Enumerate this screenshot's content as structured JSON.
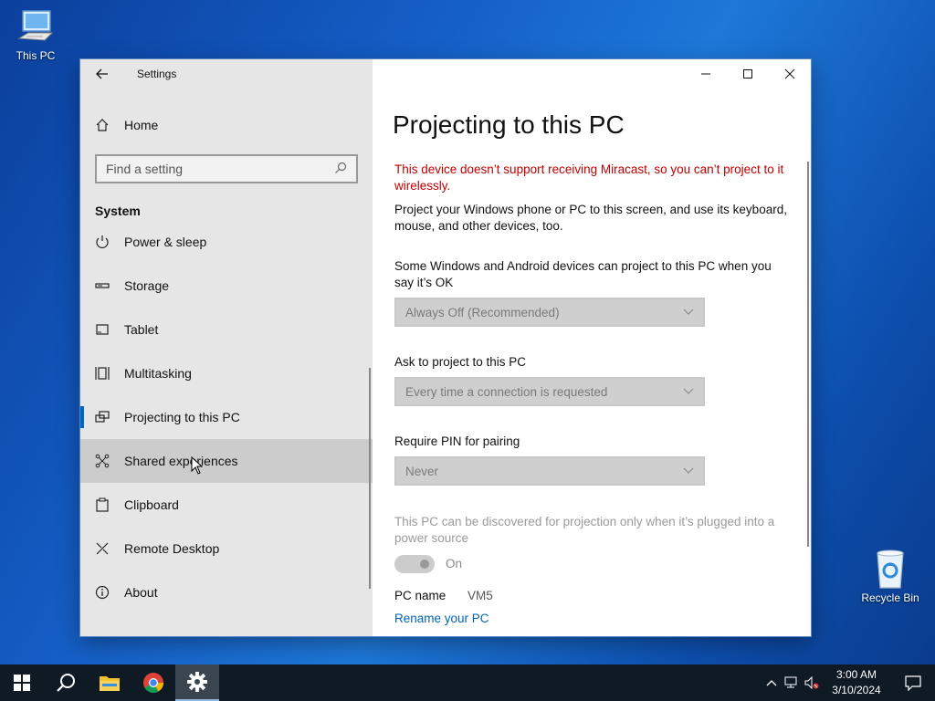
{
  "desktop": {
    "icons": [
      {
        "label": "This PC"
      },
      {
        "label": "Recycle Bin"
      }
    ]
  },
  "window": {
    "title": "Settings",
    "controls": {
      "minimize": "—",
      "maximize": "☐",
      "close": "✕"
    }
  },
  "nav": {
    "home_label": "Home",
    "search_placeholder": "Find a setting",
    "section_title": "System",
    "items": [
      {
        "label": "Power & sleep",
        "icon": "power-icon"
      },
      {
        "label": "Storage",
        "icon": "storage-icon"
      },
      {
        "label": "Tablet",
        "icon": "tablet-icon"
      },
      {
        "label": "Multitasking",
        "icon": "multitasking-icon"
      },
      {
        "label": "Projecting to this PC",
        "icon": "projecting-icon"
      },
      {
        "label": "Shared experiences",
        "icon": "shared-icon"
      },
      {
        "label": "Clipboard",
        "icon": "clipboard-icon"
      },
      {
        "label": "Remote Desktop",
        "icon": "remote-desktop-icon"
      },
      {
        "label": "About",
        "icon": "info-icon"
      }
    ],
    "selected": "Projecting to this PC",
    "hovered": "Shared experiences"
  },
  "content": {
    "title": "Projecting to this PC",
    "warning": "This device doesn’t support receiving Miracast, so you can’t project to it wirelessly.",
    "description": "Project your Windows phone or PC to this screen, and use its keyboard, mouse, and other devices, too.",
    "setting1_label": "Some Windows and Android devices can project to this PC when you say it’s OK",
    "setting1_value": "Always Off (Recommended)",
    "setting2_label": "Ask to project to this PC",
    "setting2_value": "Every time a connection is requested",
    "setting3_label": "Require PIN for pairing",
    "setting3_value": "Never",
    "power_note": "This PC can be discovered for projection only when it’s plugged into a power source",
    "toggle_state": "On",
    "pc_name_label": "PC name",
    "pc_name_value": "VM5",
    "rename_link": "Rename your PC"
  },
  "taskbar": {
    "time": "3:00 AM",
    "date": "3/10/2024"
  },
  "colors": {
    "accent": "#0067c0",
    "warning": "#c00000",
    "link": "#0063b1",
    "taskbar": "#101a25"
  }
}
